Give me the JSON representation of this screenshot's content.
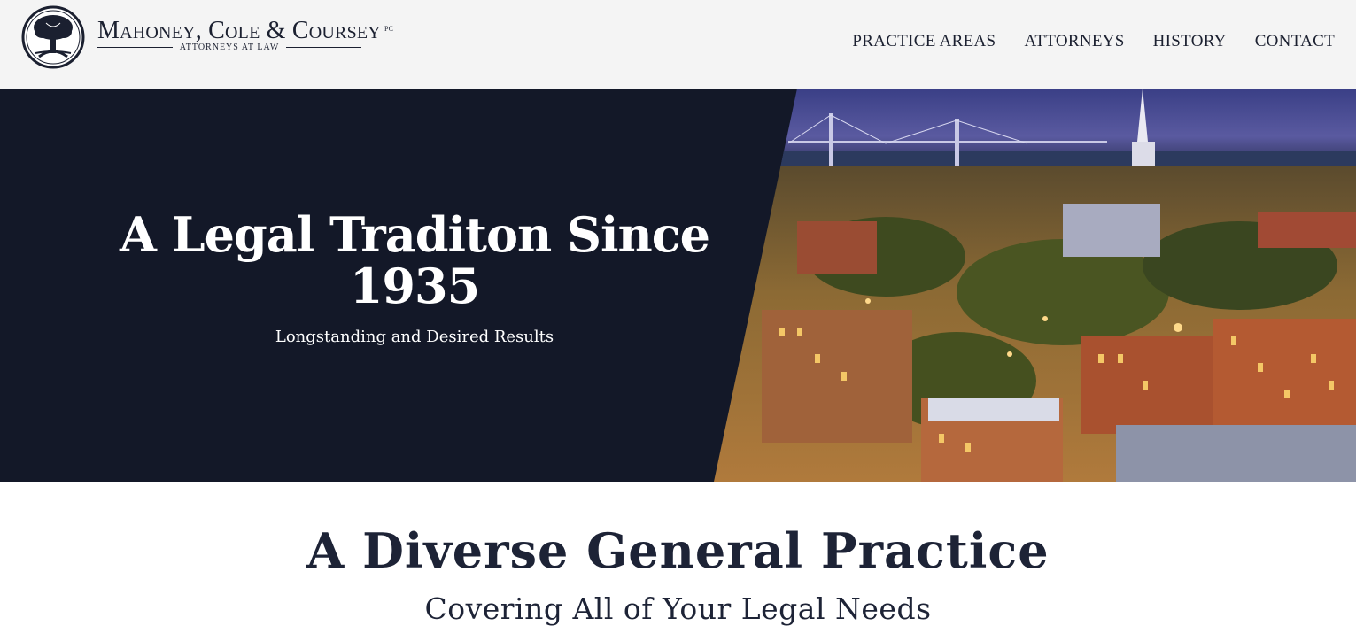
{
  "header": {
    "firm_name": "Mahoney, Cole & Coursey",
    "firm_suffix": "PC",
    "tagline": "ATTORNEYS AT LAW",
    "logo_icon": "tree-emblem-icon"
  },
  "nav": {
    "items": [
      {
        "label": "PRACTICE AREAS"
      },
      {
        "label": "ATTORNEYS"
      },
      {
        "label": "HISTORY"
      },
      {
        "label": "CONTACT"
      }
    ]
  },
  "hero": {
    "title": "A Legal Traditon Since 1935",
    "subtitle": "Longstanding and Desired Results",
    "background_color": "#131828"
  },
  "section": {
    "title": "A Diverse General Practice",
    "subtitle": "Covering All of Your Legal Needs"
  },
  "colors": {
    "header_bg": "#f4f4f4",
    "text_dark": "#1b2030",
    "accent_light": "#f4c766"
  }
}
